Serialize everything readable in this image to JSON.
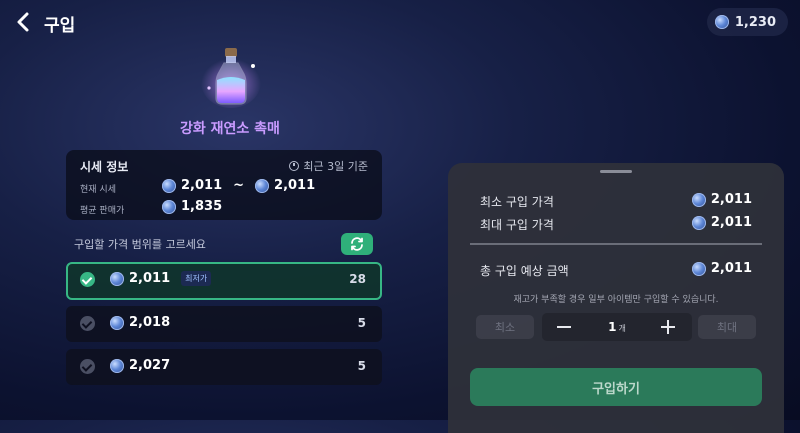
{
  "header": {
    "title": "구입",
    "currency_amount": "1,230"
  },
  "item": {
    "name": "강화 재연소 촉매",
    "icon": "potion-bottle-icon"
  },
  "market_info": {
    "title": "시세 정보",
    "basis": "최근 3일 기준",
    "current_label": "현재 시세",
    "current_min": "2,011",
    "current_sep": "~",
    "current_max": "2,011",
    "avg_label": "평균 판매가",
    "avg_value": "1,835"
  },
  "price_range": {
    "label": "구입할 가격 범위를 고르세요",
    "options": [
      {
        "price": "2,011",
        "badge": "최저가",
        "qty": "28",
        "selected": true
      },
      {
        "price": "2,018",
        "qty": "5",
        "selected": false
      },
      {
        "price": "2,027",
        "qty": "5",
        "selected": false
      }
    ]
  },
  "purchase_panel": {
    "min_price_label": "최소 구입 가격",
    "min_price": "2,011",
    "max_price_label": "최대 구입 가격",
    "max_price": "2,011",
    "total_label": "총 구입 예상 금액",
    "total": "2,011",
    "notice": "재고가 부족할 경우 일부 아이템만 구입할 수 있습니다.",
    "min_button": "최소",
    "max_button": "최대",
    "quantity": "1",
    "quantity_unit": "개",
    "buy_button": "구입하기"
  },
  "colors": {
    "accent_green": "#37b785",
    "item_name": "#c99bff",
    "buy_button": "#2b7a5a"
  }
}
